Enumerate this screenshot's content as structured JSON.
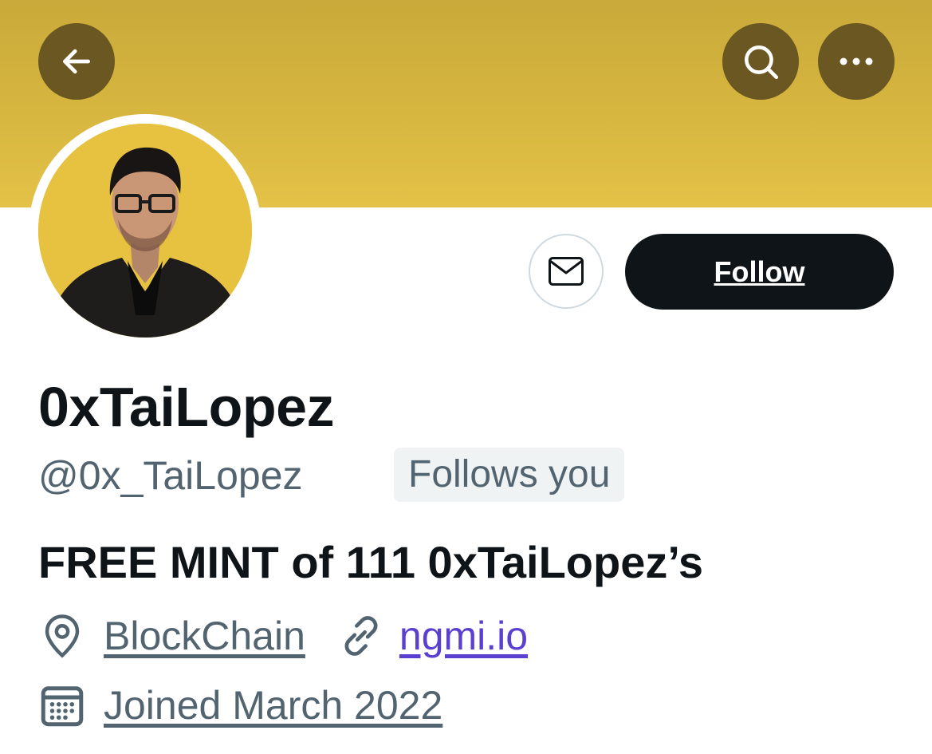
{
  "header": {
    "back_icon": "arrow-left-icon",
    "search_icon": "search-icon",
    "more_icon": "more-horizontal-icon",
    "banner_color": "#d6b53f"
  },
  "profile": {
    "display_name": "0xTaiLopez",
    "handle": "@0x_TaiLopez",
    "follows_you": "Follows you",
    "bio": "FREE MINT of 111 0xTaiLopez’s",
    "location": "BlockChain",
    "website": "ngmi.io",
    "joined": "Joined March 2022"
  },
  "actions": {
    "follow_label": "Follow",
    "message_icon": "mail-icon"
  }
}
